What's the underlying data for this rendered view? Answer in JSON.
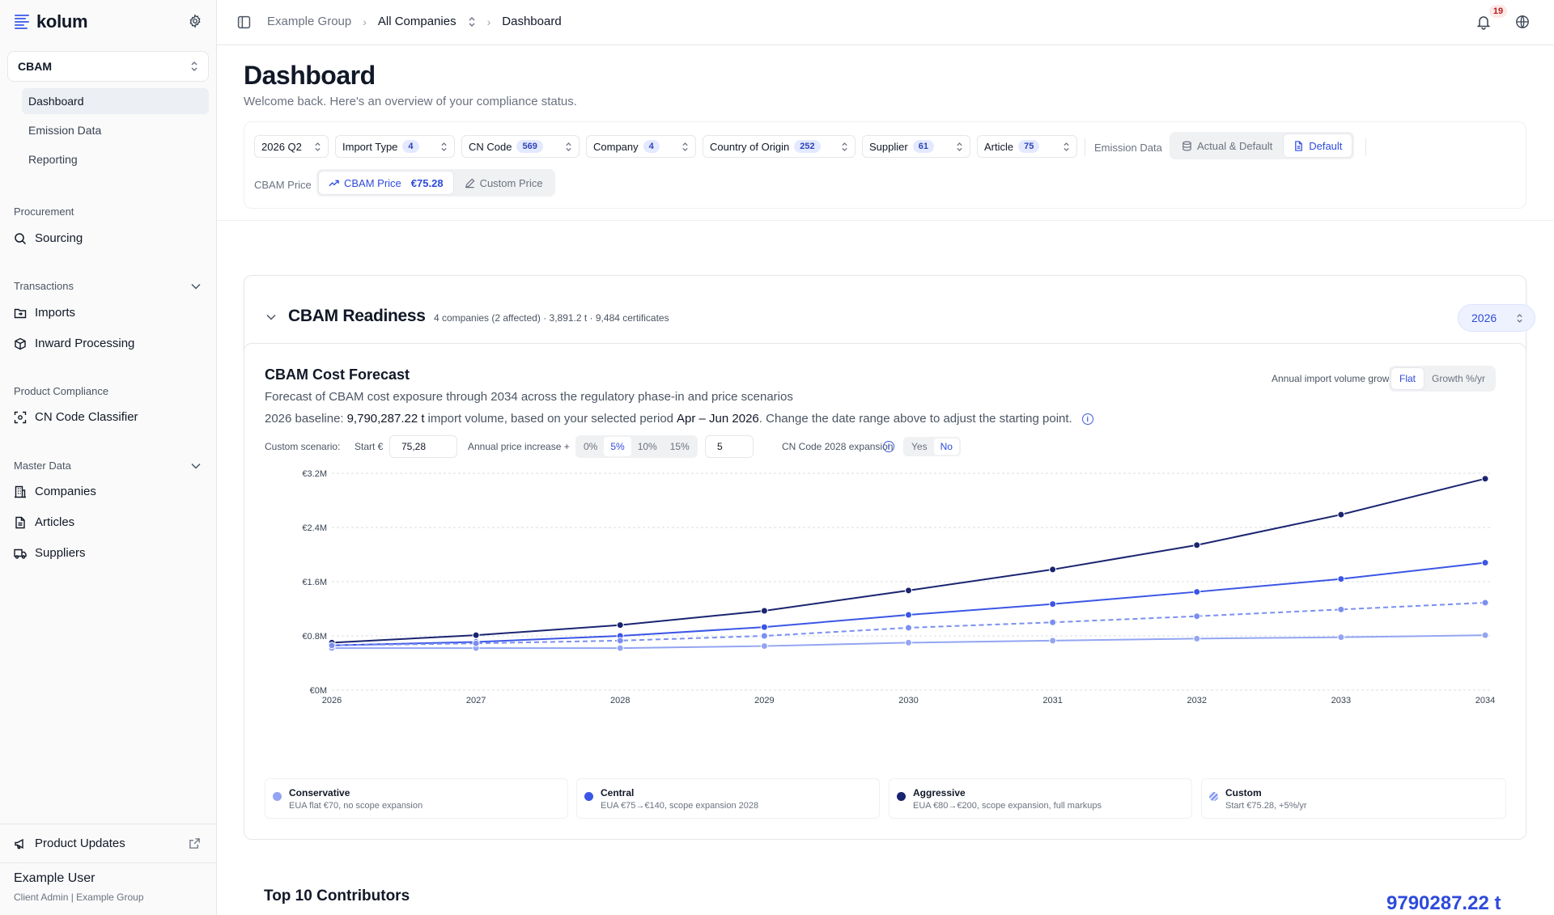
{
  "app": {
    "brand": "kolum",
    "module": "CBAM",
    "module_nav": [
      "Dashboard",
      "Emission Data",
      "Reporting"
    ],
    "sections": {
      "procurement": {
        "label": "Procurement",
        "items": [
          "Sourcing"
        ]
      },
      "transactions": {
        "label": "Transactions",
        "items": [
          "Imports",
          "Inward Processing"
        ]
      },
      "product_compliance": {
        "label": "Product Compliance",
        "items": [
          "CN Code Classifier"
        ]
      },
      "master_data": {
        "label": "Master Data",
        "items": [
          "Companies",
          "Articles",
          "Suppliers"
        ]
      }
    },
    "product_updates": "Product Updates",
    "user": {
      "name": "Example User",
      "role": "Client Admin | Example Group"
    }
  },
  "topbar": {
    "breadcrumb": [
      "Example Group",
      "All Companies",
      "Dashboard"
    ],
    "notifications": "19"
  },
  "page": {
    "title": "Dashboard",
    "subtitle": "Welcome back. Here's an overview of your compliance status."
  },
  "filters": {
    "period": "2026 Q2",
    "chips": [
      {
        "label": "Import Type",
        "count": "4"
      },
      {
        "label": "CN Code",
        "count": "569"
      },
      {
        "label": "Company",
        "count": "4"
      },
      {
        "label": "Country of Origin",
        "count": "252"
      },
      {
        "label": "Supplier",
        "count": "61"
      },
      {
        "label": "Article",
        "count": "75"
      }
    ],
    "emission_label": "Emission Data",
    "emission_options": [
      "Actual & Default",
      "Default"
    ],
    "emission_selected": "Default",
    "price_label": "CBAM Price",
    "price_options": [
      "CBAM Price",
      "Custom Price"
    ],
    "price_value": "€75.28"
  },
  "readiness": {
    "title": "CBAM Readiness",
    "meta": "4 companies (2 affected) · 3,891.2 t · 9,484 certificates",
    "year": "2026"
  },
  "forecast": {
    "title": "CBAM Cost Forecast",
    "description": "Forecast of CBAM cost exposure through 2034 across the regulatory phase-in and price scenarios",
    "baseline_prefix": "2026 baseline:",
    "baseline_value": "9,790,287.22 t",
    "baseline_mid": "import volume, based on your selected period",
    "baseline_period": "Apr – Jun 2026",
    "baseline_suffix": ". Change the date range above to adjust the starting point.",
    "growth_label": "Annual import volume growth:",
    "growth_options": [
      "Flat",
      "Growth %/yr"
    ],
    "custom_label": "Custom scenario:",
    "start_label": "Start €",
    "start_value": "75,28",
    "increase_label": "Annual price increase +",
    "increase_options": [
      "0%",
      "5%",
      "10%",
      "15%"
    ],
    "increase_value": "5",
    "expansion_label": "CN Code 2028 expansion",
    "expansion_options": [
      "Yes",
      "No"
    ],
    "legend": [
      {
        "name": "Conservative",
        "desc": "EUA flat €70, no scope expansion"
      },
      {
        "name": "Central",
        "desc": "EUA €75→€140, scope expansion 2028"
      },
      {
        "name": "Aggressive",
        "desc": "EUA €80→€200, scope expansion, full markups"
      },
      {
        "name": "Custom",
        "desc": "Start €75.28, +5%/yr"
      }
    ]
  },
  "chart_data": {
    "type": "line",
    "x": [
      2026,
      2027,
      2028,
      2029,
      2030,
      2031,
      2032,
      2033,
      2034
    ],
    "y_ticks": [
      "€0M",
      "€0.8M",
      "€1.6M",
      "€2.4M",
      "€3.2M"
    ],
    "ylim": [
      0,
      3.2
    ],
    "y_unit": "€M",
    "series": [
      {
        "name": "Conservative",
        "color": "#93a5f2",
        "dashed": false,
        "values": [
          0.62,
          0.62,
          0.62,
          0.65,
          0.7,
          0.73,
          0.76,
          0.78,
          0.81
        ]
      },
      {
        "name": "Central",
        "color": "#3b56e6",
        "dashed": false,
        "values": [
          0.66,
          0.71,
          0.8,
          0.93,
          1.11,
          1.27,
          1.45,
          1.64,
          1.88
        ]
      },
      {
        "name": "Aggressive",
        "color": "#1a2470",
        "dashed": false,
        "values": [
          0.7,
          0.81,
          0.96,
          1.17,
          1.47,
          1.78,
          2.14,
          2.59,
          3.12
        ]
      },
      {
        "name": "Custom",
        "color": "#7b8ff0",
        "dashed": true,
        "values": [
          0.66,
          0.69,
          0.73,
          0.8,
          0.92,
          1.0,
          1.09,
          1.19,
          1.29
        ]
      }
    ],
    "grid": true
  },
  "top10": {
    "title": "Top 10 Contributors",
    "total": "9790287.22 t"
  }
}
